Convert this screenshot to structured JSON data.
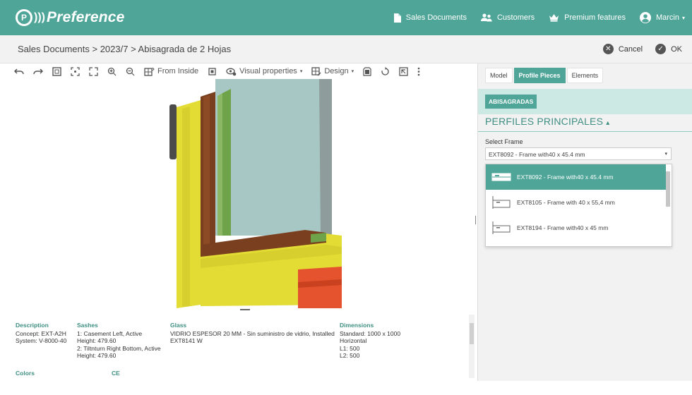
{
  "app": {
    "logo_mark": "P",
    "logo_waves": ")))",
    "logo_text": "Preference"
  },
  "topnav": {
    "sales_documents": "Sales Documents",
    "customers": "Customers",
    "premium": "Premium features",
    "user": "Marcin",
    "user_caret": "▾"
  },
  "breadcrumb": "Sales Documents > 2023/7 > Abisagrada de 2 Hojas",
  "actions": {
    "cancel": "Cancel",
    "ok": "OK"
  },
  "toolbar": {
    "from_inside": "From Inside",
    "visual_properties": "Visual properties",
    "design": "Design",
    "caret": "▾"
  },
  "info": {
    "description": {
      "header": "Description",
      "concept_label": "Concept:",
      "concept_value": "EXT-A2H",
      "system_label": "System:",
      "system_value": "V-8000-40"
    },
    "sashes": {
      "header": "Sashes",
      "s1": "1: Casement Left, Active",
      "s1_height": "Height: 479.60",
      "s2": "2: Tiltnturn Right Bottom, Active",
      "s2_height": "Height: 479.60"
    },
    "glass": {
      "header": "Glass",
      "line1": "VIDRIO ESPESOR 20 MM - Sin suministro de vidrio, Installed",
      "line2": "EXT8141 W"
    },
    "dimensions": {
      "header": "Dimensions",
      "standard_label": "Standard:",
      "standard_value": "1000 x 1000",
      "orientation": "Horizontal",
      "l1": "L1: 500",
      "l2": "L2: 500"
    },
    "colors_header": "Colors",
    "ce_header": "CE"
  },
  "panel": {
    "tabs": [
      "Model",
      "Profile Pieces",
      "Elements"
    ],
    "active_tab": "Profile Pieces",
    "group_button": "ABISAGRADAS",
    "section_title": "PERFILES PRINCIPALES",
    "section_caret": "▴",
    "select_label": "Select Frame",
    "select_value": "EXT8092 - Frame with40 x 45.4 mm",
    "select_caret": "▾",
    "options": [
      "EXT8092 - Frame with40 x 45.4 mm",
      "EXT8105 - Frame with 40 x 55,4 mm",
      "EXT8194 - Frame with40 x 45 mm"
    ],
    "selected_option": 0
  },
  "colors": {
    "accent": "#4fa597",
    "accent_light": "#cce9e4",
    "profile_yellow": "#e3dc34",
    "profile_brown": "#7a3f1e",
    "profile_red": "#e4532d",
    "glass": "#a7c7c5",
    "seal_green": "#6ea34a",
    "handle": "#4b4b4b"
  }
}
